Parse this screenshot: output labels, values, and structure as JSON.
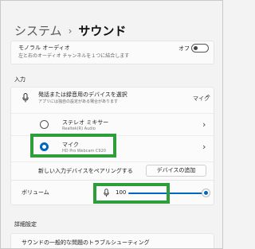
{
  "header": {
    "breadcrumb_parent": "システム",
    "separator": "›",
    "current": "サウンド"
  },
  "mono_audio": {
    "title": "モノラル オーディオ",
    "description": "左と右のオーディオ チャンネルを１つに結合します",
    "toggle_label": "オフ",
    "toggle_on": false
  },
  "input_section": {
    "label": "入力",
    "header_title": "発話または録音用のデバイスを選択",
    "header_desc": "アプリには独自の設定がある場合があります",
    "header_value": "マイク",
    "header_chevron": "^",
    "devices": [
      {
        "name": "ステレオ ミキサー",
        "sub": "Realtek(R) Audio",
        "selected": false,
        "chevron": "›"
      },
      {
        "name": "マイク",
        "sub": "HD Pro Webcam C920",
        "selected": true,
        "chevron": "›"
      }
    ],
    "pair_label": "新しい入力デバイスをペアリングする",
    "add_button": "デバイスの追加"
  },
  "volume": {
    "label": "ボリューム",
    "value": "100",
    "level_percent": 100
  },
  "advanced": {
    "label": "詳細設定",
    "troubleshoot": "サウンドの一般的な問題のトラブルシューティング"
  },
  "colors": {
    "accent": "#0067c0",
    "highlight": "#2e9e3a"
  }
}
